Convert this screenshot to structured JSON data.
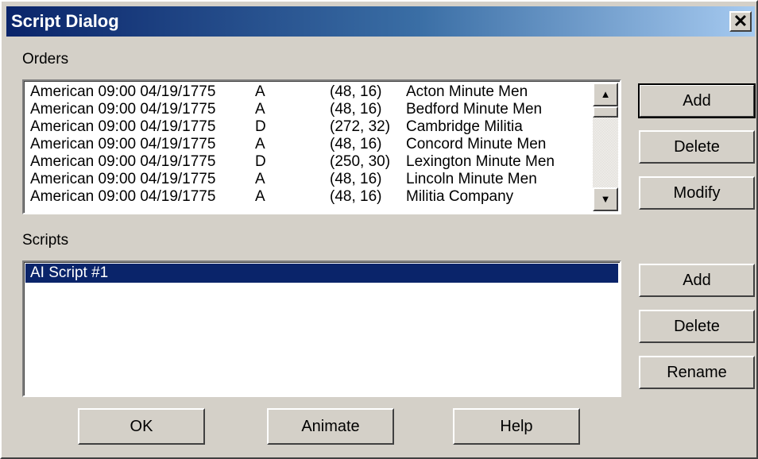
{
  "window": {
    "title": "Script Dialog",
    "close_glyph": "✕"
  },
  "orders": {
    "label": "Orders",
    "rows": [
      {
        "side": "American",
        "time": "09:00 04/19/1775",
        "code": "A",
        "pos": "(48, 16)",
        "unit": "Acton Minute Men"
      },
      {
        "side": "American",
        "time": "09:00 04/19/1775",
        "code": "A",
        "pos": "(48, 16)",
        "unit": "Bedford Minute Men"
      },
      {
        "side": "American",
        "time": "09:00 04/19/1775",
        "code": "D",
        "pos": "(272, 32)",
        "unit": "Cambridge Militia"
      },
      {
        "side": "American",
        "time": "09:00 04/19/1775",
        "code": "A",
        "pos": "(48, 16)",
        "unit": "Concord Minute Men"
      },
      {
        "side": "American",
        "time": "09:00 04/19/1775",
        "code": "D",
        "pos": "(250, 30)",
        "unit": "Lexington Minute Men"
      },
      {
        "side": "American",
        "time": "09:00 04/19/1775",
        "code": "A",
        "pos": "(48, 16)",
        "unit": "Lincoln Minute Men"
      },
      {
        "side": "American",
        "time": "09:00 04/19/1775",
        "code": "A",
        "pos": "(48, 16)",
        "unit": "Militia Company"
      }
    ],
    "buttons": {
      "add": "Add",
      "delete": "Delete",
      "modify": "Modify"
    }
  },
  "scripts": {
    "label": "Scripts",
    "items": [
      {
        "label": "AI Script #1",
        "selected": true
      }
    ],
    "buttons": {
      "add": "Add",
      "delete": "Delete",
      "rename": "Rename"
    }
  },
  "footer": {
    "ok": "OK",
    "animate": "Animate",
    "help": "Help"
  },
  "icons": {
    "scroll_up": "arrow-up-icon",
    "scroll_down": "arrow-down-icon",
    "close": "close-icon"
  },
  "colors": {
    "title_start": "#0a246a",
    "title_end": "#a6caf0",
    "face": "#d4d0c8",
    "selection": "#0a246a"
  }
}
